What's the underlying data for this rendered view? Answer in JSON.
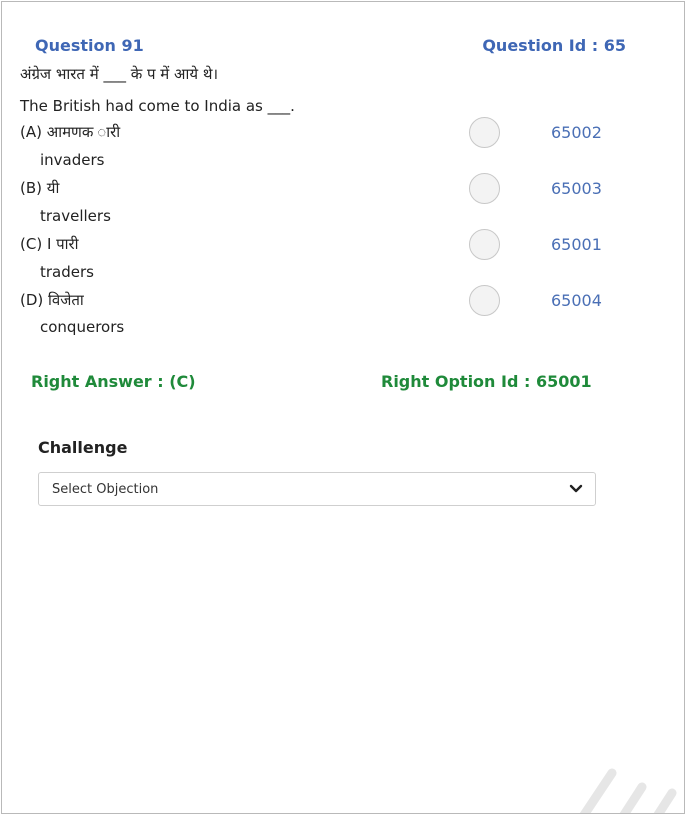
{
  "question": {
    "number_label": "Question 91",
    "id_label": "Question Id : 65",
    "text_hi": "अंग्रेज भारत में ___ के प    में आये थे।",
    "text_en": "The British had come to India as ___."
  },
  "options": [
    {
      "hi": "(A) आमणक    ारी",
      "en": "invaders",
      "id": "65002"
    },
    {
      "hi": "(B) यी",
      "en": "travellers",
      "id": "65003"
    },
    {
      "hi": "(C) I    पारी",
      "en": "traders",
      "id": "65001"
    },
    {
      "hi": "(D) विजेता",
      "en": "conquerors",
      "id": "65004"
    }
  ],
  "answer": {
    "right_answer": "Right Answer : (C)",
    "right_option_id": "Right Option Id : 65001"
  },
  "challenge": {
    "label": "Challenge",
    "select_value": "Select Objection"
  },
  "colors": {
    "accent_blue": "#3f67b5",
    "answer_green": "#1f8a3a"
  },
  "icons": {
    "dropdown": "chevron-down-icon"
  }
}
